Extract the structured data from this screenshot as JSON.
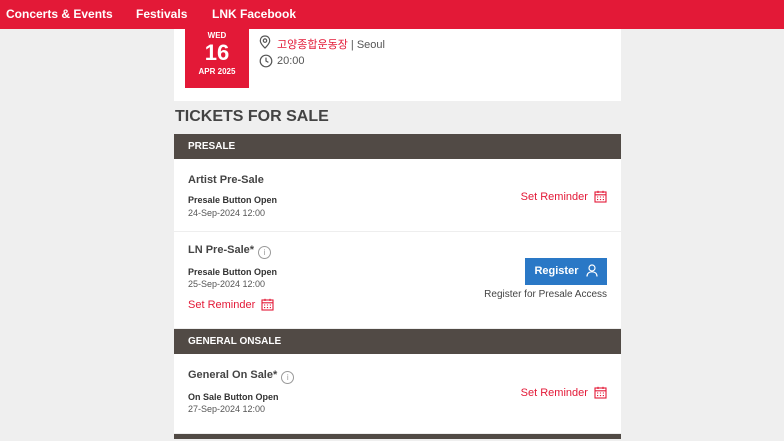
{
  "nav": {
    "concerts": "Concerts & Events",
    "festivals": "Festivals",
    "facebook": "LNK Facebook"
  },
  "event": {
    "dow": "WED",
    "day": "16",
    "month": "APR 2025",
    "venue": "고양종합운동장",
    "city": " | Seoul",
    "time": "20:00"
  },
  "tickets": {
    "title": "TICKETS FOR SALE",
    "presale_header": "PRESALE",
    "general_header": "GENERAL ONSALE",
    "rows": [
      {
        "name": "Artist Pre-Sale",
        "status": "Presale Button Open",
        "date": "24-Sep-2024 12:00",
        "reminder": "Set Reminder"
      },
      {
        "name": "LN Pre-Sale*",
        "status": "Presale Button Open",
        "date": "25-Sep-2024 12:00",
        "reminder": "Set Reminder",
        "register": "Register",
        "register_note": "Register for Presale Access"
      },
      {
        "name": "General On Sale*",
        "status": "On Sale Button Open",
        "date": "27-Sep-2024 12:00",
        "reminder": "Set Reminder"
      }
    ]
  },
  "icons": {
    "info": "i",
    "pin": "location-pin-icon",
    "clock": "clock-icon",
    "calendar": "calendar-icon",
    "user": "user-icon"
  },
  "colors": {
    "brand_red": "#e31937",
    "header_brown": "#514a45",
    "button_blue": "#2a78c6"
  }
}
